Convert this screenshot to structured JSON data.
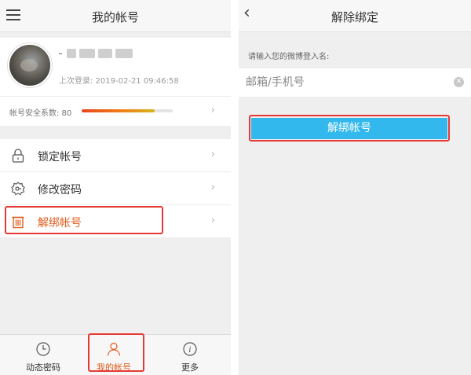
{
  "left": {
    "header": {
      "title": "我的帐号",
      "menu_icon": "hamburger-menu-icon"
    },
    "profile": {
      "username_prefix": "-",
      "last_login": "上次登录: 2019-02-21 09:46:58"
    },
    "safety": {
      "label": "帐号安全系数: 80",
      "score_fraction": 0.8
    },
    "menu": [
      {
        "label": "锁定帐号",
        "icon": "lock-icon"
      },
      {
        "label": "修改密码",
        "icon": "key-gear-icon"
      },
      {
        "label": "解绑帐号",
        "icon": "trash-icon"
      }
    ],
    "tabs": [
      {
        "label": "动态密码",
        "icon": "clock-icon"
      },
      {
        "label": "我的帐号",
        "icon": "person-icon",
        "active": true
      },
      {
        "label": "更多",
        "icon": "info-icon"
      }
    ]
  },
  "right": {
    "header": {
      "title": "解除绑定",
      "back_icon": "back-chevron-icon"
    },
    "prompt": "请输入您的微博登入名:",
    "input": {
      "placeholder": "邮箱/手机号",
      "value": ""
    },
    "button_label": "解绑帐号"
  },
  "colors": {
    "accent_orange": "#e05c1e",
    "highlight_red": "#e53935",
    "button_blue": "#32b8ec"
  }
}
